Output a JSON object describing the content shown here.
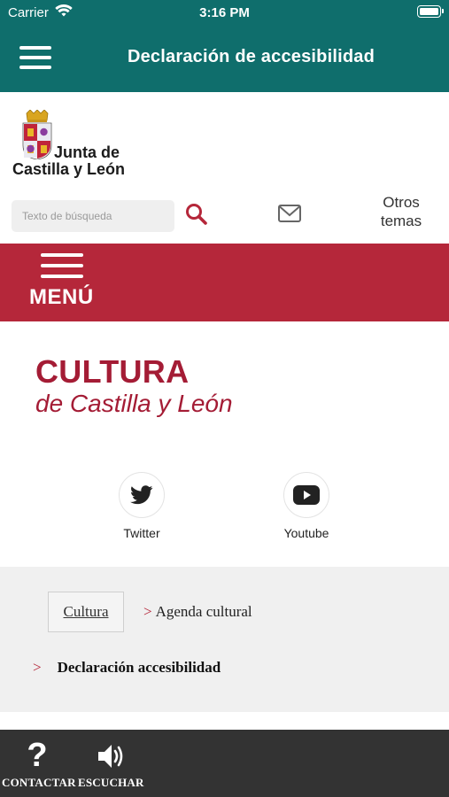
{
  "status_bar": {
    "carrier": "Carrier",
    "time": "3:16 PM"
  },
  "nav": {
    "title": "Declaración de accesibilidad",
    "menu_icon": "hamburger-icon"
  },
  "logo": {
    "line1": "Junta de",
    "line2": "Castilla y León"
  },
  "search": {
    "placeholder": "Texto de búsqueda",
    "value": ""
  },
  "header_links": {
    "otros_line1": "Otros",
    "otros_line2": "temas"
  },
  "menu_bar": {
    "label": "MENÚ"
  },
  "hero": {
    "title": "CULTURA",
    "subtitle": "de Castilla y León"
  },
  "social": [
    {
      "label": "Twitter",
      "icon": "twitter-icon"
    },
    {
      "label": "Youtube",
      "icon": "youtube-icon"
    }
  ],
  "breadcrumb": {
    "root": "Cultura",
    "separator": ">",
    "level2": "Agenda cultural",
    "current": "Declaración accesibilidad"
  },
  "bottom_bar": {
    "contactar": "CONTACTAR",
    "escuchar": "ESCUCHAR"
  },
  "colors": {
    "teal": "#0f6e6c",
    "red": "#b5273a",
    "dark": "#333333",
    "hero": "#a41c35"
  }
}
